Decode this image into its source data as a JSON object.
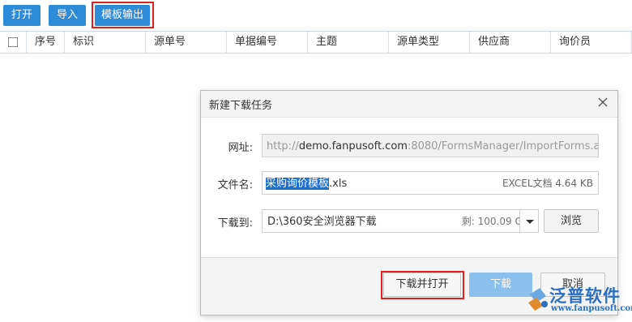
{
  "toolbar": {
    "open_label": "打开",
    "import_label": "导入",
    "template_export_label": "模板输出"
  },
  "grid": {
    "columns": [
      "序号",
      "标识",
      "源单号",
      "单据编号",
      "主题",
      "源单类型",
      "供应商",
      "询价员"
    ]
  },
  "dialog": {
    "title": "新建下载任务",
    "url_label": "网址:",
    "url_prefix": "http://",
    "url_domain": "demo.fanpusoft.com",
    "url_rest": ":8080/FormsManager/ImportForms.aspx?Fo",
    "filename_label": "文件名:",
    "filename_selected": "采购询价模板",
    "filename_ext": ".xls",
    "file_info": "EXCEL文档 4.64 KB",
    "dir_label": "下载到:",
    "dir_path": "D:\\360安全浏览器下载",
    "dir_free": "剩: 100.09 GB",
    "browse_label": "浏览",
    "open_after_label": "下载并打开",
    "download_label": "下载",
    "cancel_label": "取消"
  },
  "watermark": {
    "brand": "泛普软件",
    "site": "www.fanpusoft.com"
  },
  "colors": {
    "primary_button": "#2e8bd8",
    "highlight_outline": "#e02020",
    "download_button": "#8cc0ec",
    "selection": "#1c6fd0"
  }
}
